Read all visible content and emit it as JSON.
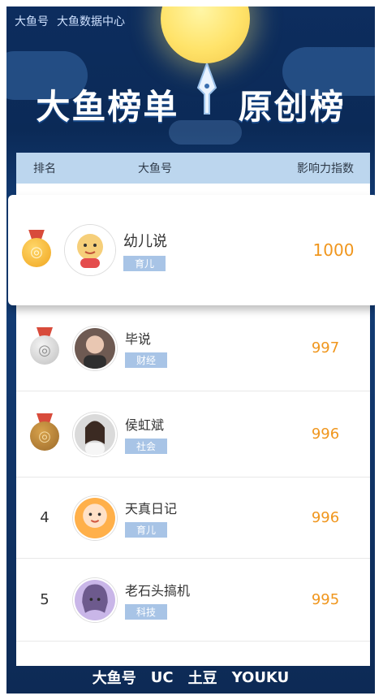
{
  "header": {
    "brand_logo": "大鱼号",
    "data_center": "大鱼数据中心",
    "title": "大鱼榜单",
    "subtitle": "原创榜"
  },
  "table": {
    "columns": [
      "排名",
      "大鱼号",
      "影响力指数"
    ],
    "rows": [
      {
        "rank": "1",
        "medal": "gold",
        "avatar_icon": "baby-avatar",
        "name": "幼儿说",
        "tag": "育儿",
        "score": "1000"
      },
      {
        "rank": "2",
        "medal": "silver",
        "avatar_icon": "man-avatar",
        "name": "毕说",
        "tag": "财经",
        "score": "997"
      },
      {
        "rank": "3",
        "medal": "bronze",
        "avatar_icon": "woman-avatar",
        "name": "侯虹斌",
        "tag": "社会",
        "score": "996"
      },
      {
        "rank": "4",
        "medal": "",
        "avatar_icon": "cartoon-baby-avatar",
        "name": "天真日记",
        "tag": "育儿",
        "score": "996"
      },
      {
        "rank": "5",
        "medal": "",
        "avatar_icon": "anime-avatar",
        "name": "老石头搞机",
        "tag": "科技",
        "score": "995"
      }
    ]
  },
  "footer": {
    "logos": [
      "大鱼号",
      "UC",
      "土豆",
      "YOUKU"
    ]
  },
  "colors": {
    "accent_score": "#f0961d",
    "header_bar": "#bcd6ee",
    "tag_bg": "#a8c4e6"
  }
}
